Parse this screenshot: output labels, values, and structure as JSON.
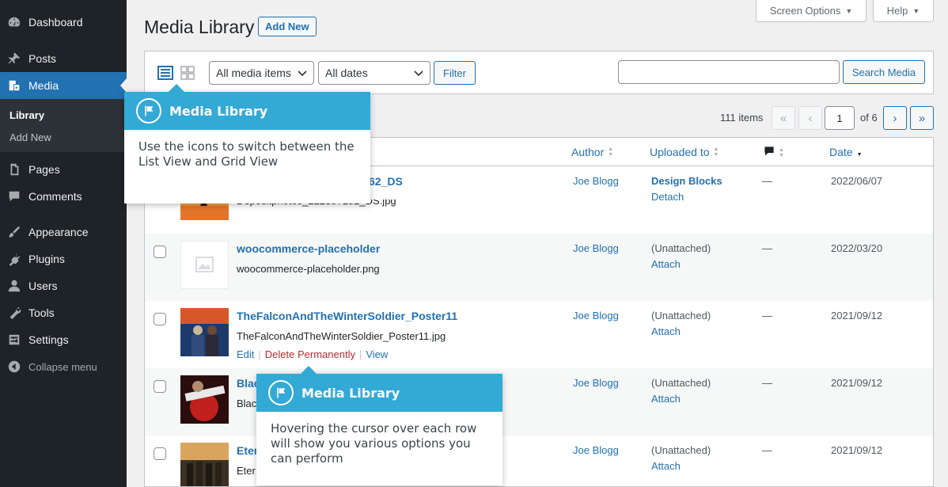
{
  "sidebar": {
    "items": [
      {
        "label": "Dashboard",
        "icon": "dashboard-icon"
      },
      {
        "label": "Posts",
        "icon": "pin-icon"
      },
      {
        "label": "Media",
        "icon": "media-icon"
      },
      {
        "label": "Pages",
        "icon": "pages-icon"
      },
      {
        "label": "Comments",
        "icon": "comment-icon"
      },
      {
        "label": "Appearance",
        "icon": "brush-icon"
      },
      {
        "label": "Plugins",
        "icon": "plugin-icon"
      },
      {
        "label": "Users",
        "icon": "user-icon"
      },
      {
        "label": "Tools",
        "icon": "wrench-icon"
      },
      {
        "label": "Settings",
        "icon": "settings-icon"
      }
    ],
    "submenu": [
      {
        "label": "Library"
      },
      {
        "label": "Add New"
      }
    ],
    "collapse_label": "Collapse menu",
    "colors": {
      "bg": "#1d2327",
      "active": "#2271b1"
    }
  },
  "header": {
    "screen_options": "Screen Options",
    "help": "Help",
    "title": "Media Library",
    "add_new": "Add New"
  },
  "filters": {
    "media_type": "All media items",
    "dates": "All dates",
    "filter_button": "Filter",
    "search_value": "",
    "search_button": "Search Media"
  },
  "pagination": {
    "items_count": "111 items",
    "first": "«",
    "prev": "‹",
    "current_page": "1",
    "of_pages": "of 6",
    "next": "›",
    "last": "»"
  },
  "table": {
    "columns": {
      "author": "Author",
      "uploaded_to": "Uploaded to",
      "date": "Date"
    },
    "rows": [
      {
        "title": "62_DS",
        "file": "Depositphotos_222357182_DS.jpg",
        "author": "Joe Blogg",
        "uploaded_to": "Design Blocks",
        "upload_action": "Detach",
        "comments": "—",
        "date": "2022/06/07"
      },
      {
        "title": "woocommerce-placeholder",
        "file": "woocommerce-placeholder.png",
        "author": "Joe Blogg",
        "uploaded_to": "(Unattached)",
        "upload_action": "Attach",
        "comments": "—",
        "date": "2022/03/20"
      },
      {
        "title": "TheFalconAndTheWinterSoldier_Poster11",
        "file": "TheFalconAndTheWinterSoldier_Poster11.jpg",
        "author": "Joe Blogg",
        "uploaded_to": "(Unattached)",
        "upload_action": "Attach",
        "comments": "—",
        "date": "2021/09/12",
        "actions": {
          "edit": "Edit",
          "delete": "Delete Permanently",
          "view": "View",
          "sep": "|"
        }
      },
      {
        "title": "Blac",
        "file": "Blac",
        "author": "Joe Blogg",
        "uploaded_to": "(Unattached)",
        "upload_action": "Attach",
        "comments": "—",
        "date": "2021/09/12"
      },
      {
        "title": "Eter",
        "file": "Eter",
        "author": "Joe Blogg",
        "uploaded_to": "(Unattached)",
        "upload_action": "Attach",
        "comments": "—",
        "date": "2021/09/12"
      }
    ]
  },
  "tooltips": [
    {
      "title": "Media Library",
      "body": "Use the icons to switch between the List View and Grid View"
    },
    {
      "title": "Media Library",
      "body": "Hovering the cursor over each row will show you various options you can perform"
    }
  ]
}
